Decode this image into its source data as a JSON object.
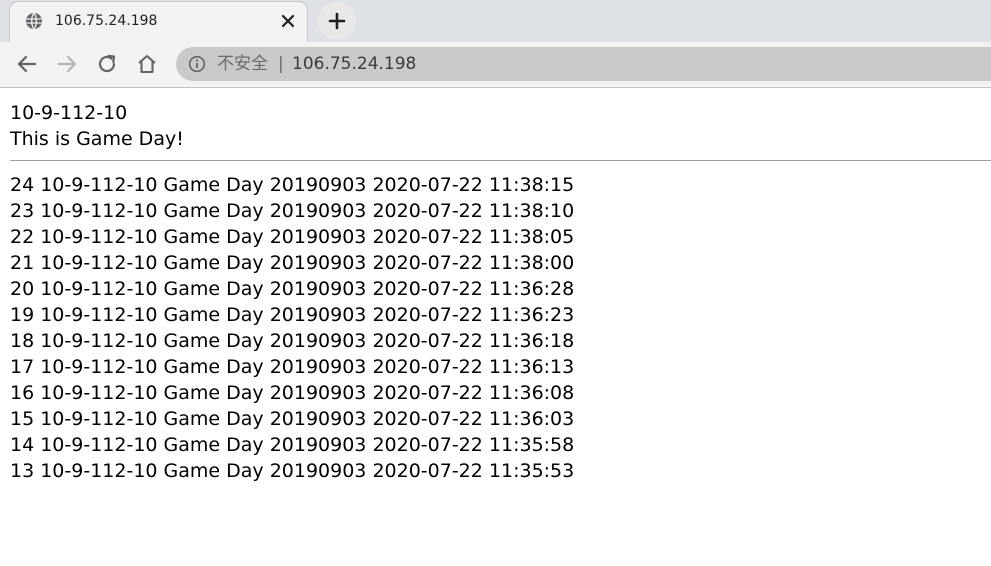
{
  "browser": {
    "tab": {
      "title": "106.75.24.198",
      "favicon": "globe-icon",
      "close_icon": "close-icon"
    },
    "new_tab_icon": "plus-icon",
    "nav": {
      "back_icon": "arrow-left-icon",
      "forward_icon": "arrow-right-icon",
      "reload_icon": "reload-icon",
      "home_icon": "home-icon"
    },
    "address_bar": {
      "security_icon": "info-circle-icon",
      "security_label": "不安全",
      "divider": "|",
      "url": "106.75.24.198"
    }
  },
  "page": {
    "heading": "10-9-112-10",
    "subheading": "This is Game Day!",
    "records": [
      "24 10-9-112-10 Game Day 20190903 2020-07-22 11:38:15",
      "23 10-9-112-10 Game Day 20190903 2020-07-22 11:38:10",
      "22 10-9-112-10 Game Day 20190903 2020-07-22 11:38:05",
      "21 10-9-112-10 Game Day 20190903 2020-07-22 11:38:00",
      "20 10-9-112-10 Game Day 20190903 2020-07-22 11:36:28",
      "19 10-9-112-10 Game Day 20190903 2020-07-22 11:36:23",
      "18 10-9-112-10 Game Day 20190903 2020-07-22 11:36:18",
      "17 10-9-112-10 Game Day 20190903 2020-07-22 11:36:13",
      "16 10-9-112-10 Game Day 20190903 2020-07-22 11:36:08",
      "15 10-9-112-10 Game Day 20190903 2020-07-22 11:36:03",
      "14 10-9-112-10 Game Day 20190903 2020-07-22 11:35:58",
      "13 10-9-112-10 Game Day 20190903 2020-07-22 11:35:53"
    ]
  }
}
